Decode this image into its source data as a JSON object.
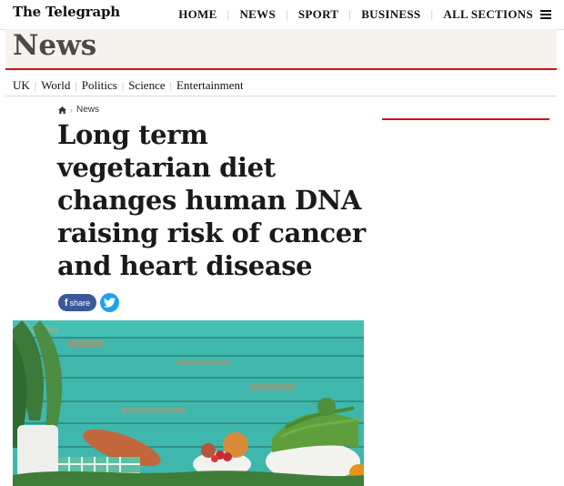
{
  "masthead": {
    "logo": "The Telegraph",
    "nav": [
      "HOME",
      "NEWS",
      "SPORT",
      "BUSINESS",
      "ALL SECTIONS"
    ],
    "menu_icon": "hamburger-menu-icon"
  },
  "section": {
    "title": "News",
    "accent_color": "#d0111b",
    "banner_bg": "#f6f2ee"
  },
  "subnav": {
    "items": [
      "UK",
      "World",
      "Politics",
      "Science",
      "Entertainment"
    ]
  },
  "breadcrumb": {
    "home_icon": "home-icon",
    "current": "News"
  },
  "article": {
    "headline": "Long term vegetarian diet changes human DNA raising risk of cancer and heart disease"
  },
  "share": {
    "facebook_label": "share",
    "facebook_color": "#3b5998",
    "twitter_color": "#1da1f2",
    "twitter_icon": "twitter-bird-icon"
  }
}
